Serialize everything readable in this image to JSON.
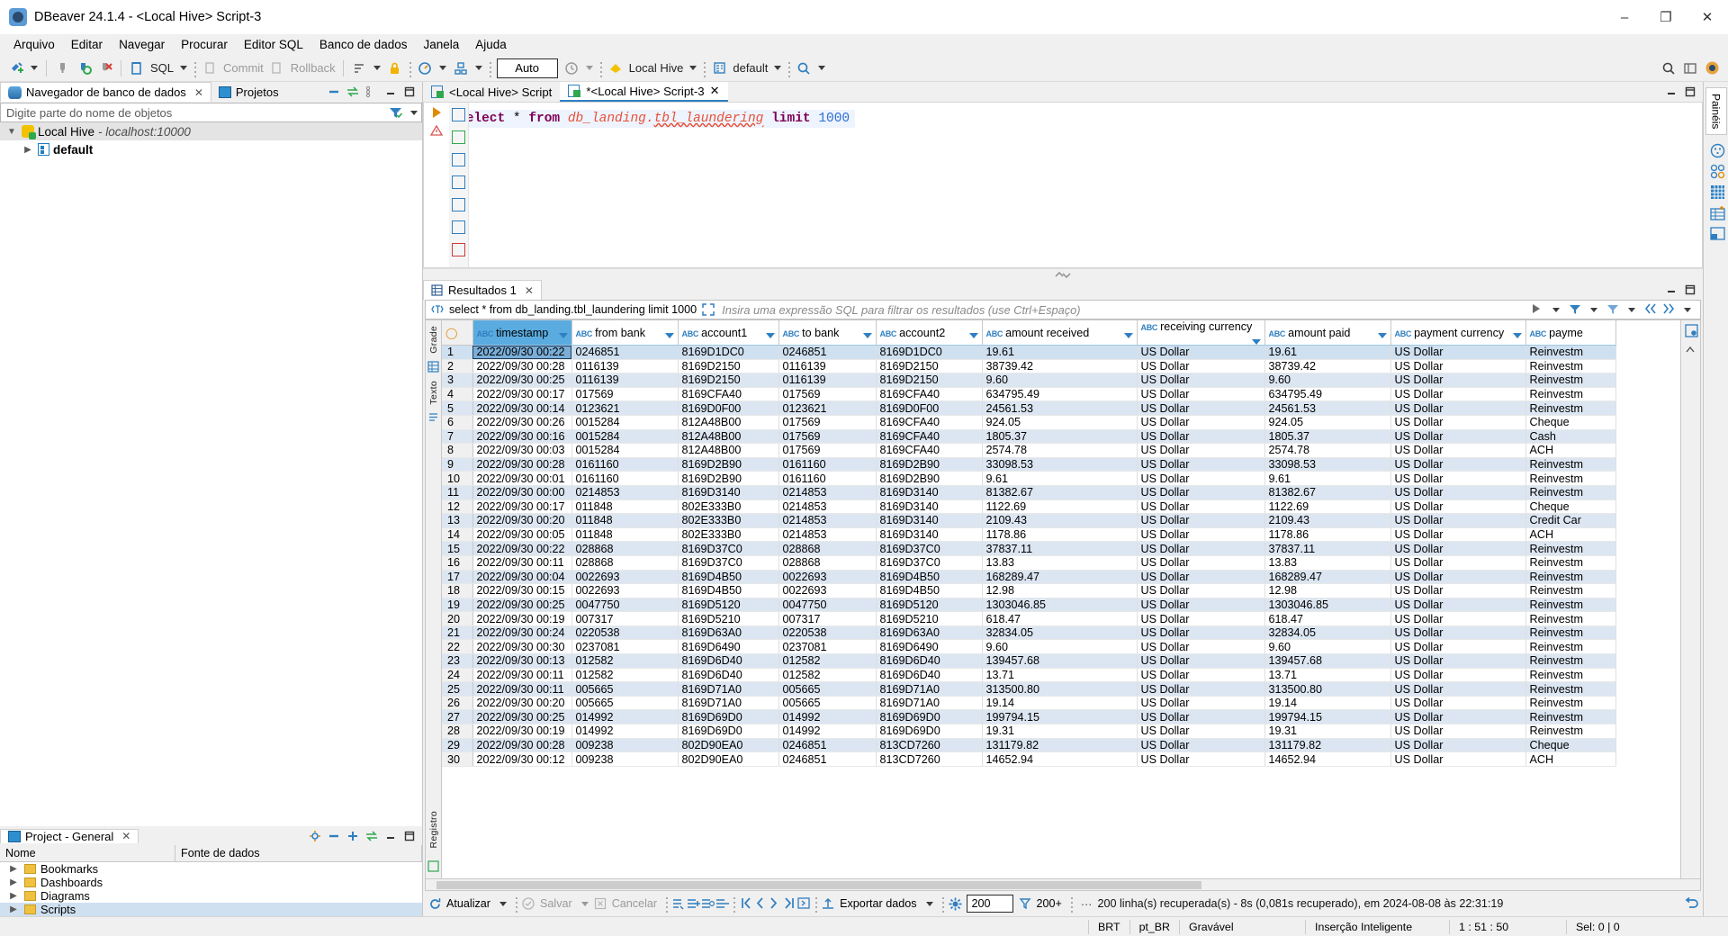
{
  "window": {
    "title": "DBeaver 24.1.4 - <Local Hive> Script-3",
    "minimize": "–",
    "maximize": "❐",
    "close": "✕"
  },
  "menu": [
    "Arquivo",
    "Editar",
    "Navegar",
    "Procurar",
    "Editor SQL",
    "Banco de dados",
    "Janela",
    "Ajuda"
  ],
  "toolbar": {
    "sql_label": "SQL",
    "commit_label": "Commit",
    "rollback_label": "Rollback",
    "auto_label": "Auto",
    "connection_label": "Local Hive",
    "database_label": "default",
    "icons": {
      "new_connection": "new-connection-icon",
      "disconnect": "disconnect-icon",
      "refresh_connection": "refresh-connection-icon",
      "terminate": "terminate-icon",
      "sql_editor": "sql-editor-icon",
      "commit": "commit-icon",
      "rollback": "rollback-icon",
      "transaction_mode": "transaction-mode-icon",
      "lock": "lock-icon",
      "dashboard": "dashboard-icon",
      "schema": "schema-icon",
      "history": "history-icon",
      "search": "search-icon",
      "perspective": "perspective-icon"
    }
  },
  "navigator": {
    "tab_label": "Navegador de banco de dados",
    "projects_tab": "Projetos",
    "filter_placeholder": "Digite parte do nome de objetos",
    "tree": [
      {
        "label": "Local Hive",
        "detail": "- localhost:10000",
        "selected": true,
        "expanded": true
      },
      {
        "label": "default",
        "detail": "",
        "selected": false,
        "expanded": false
      }
    ]
  },
  "project_panel": {
    "tab_label": "Project - General",
    "columns": [
      "Nome",
      "Fonte de dados"
    ],
    "rows": [
      {
        "label": "Bookmarks",
        "selected": false
      },
      {
        "label": "Dashboards",
        "selected": false
      },
      {
        "label": "Diagrams",
        "selected": false
      },
      {
        "label": "Scripts",
        "selected": true
      }
    ]
  },
  "editor": {
    "tabs": [
      {
        "label": "<Local Hive> Script",
        "active": false,
        "closable": false
      },
      {
        "label": "*<Local Hive> Script-3",
        "active": true,
        "closable": true
      }
    ],
    "sql": {
      "keyword1": "select",
      "star": "*",
      "keyword2": "from",
      "schema": "db_landing",
      "dot": ".",
      "table": "tbl_laundering",
      "keyword3": "limit",
      "number": "1000"
    }
  },
  "results": {
    "tab_label": "Resultados 1",
    "query_label": "select * from db_landing.tbl_laundering limit 1000",
    "filter_placeholder": "Insira uma expressão SQL para filtrar os resultados (use Ctrl+Espaço)",
    "side_tabs": [
      "Grade",
      "Texto"
    ],
    "side_tab_bottom": "Registro",
    "panels_tab": "Painéis",
    "columns": [
      "timestamp",
      "from bank",
      "account1",
      "to bank",
      "account2",
      "amount received",
      "receiving currency",
      "amount paid",
      "payment currency",
      "payme"
    ],
    "selected_column": "timestamp",
    "rows": [
      [
        "2022/09/30 00:22",
        "0246851",
        "8169D1DC0",
        "0246851",
        "8169D1DC0",
        "19.61",
        "US Dollar",
        "19.61",
        "US Dollar",
        "Reinvestm"
      ],
      [
        "2022/09/30 00:28",
        "0116139",
        "8169D2150",
        "0116139",
        "8169D2150",
        "38739.42",
        "US Dollar",
        "38739.42",
        "US Dollar",
        "Reinvestm"
      ],
      [
        "2022/09/30 00:25",
        "0116139",
        "8169D2150",
        "0116139",
        "8169D2150",
        "9.60",
        "US Dollar",
        "9.60",
        "US Dollar",
        "Reinvestm"
      ],
      [
        "2022/09/30 00:17",
        "017569",
        "8169CFA40",
        "017569",
        "8169CFA40",
        "634795.49",
        "US Dollar",
        "634795.49",
        "US Dollar",
        "Reinvestm"
      ],
      [
        "2022/09/30 00:14",
        "0123621",
        "8169D0F00",
        "0123621",
        "8169D0F00",
        "24561.53",
        "US Dollar",
        "24561.53",
        "US Dollar",
        "Reinvestm"
      ],
      [
        "2022/09/30 00:26",
        "0015284",
        "812A48B00",
        "017569",
        "8169CFA40",
        "924.05",
        "US Dollar",
        "924.05",
        "US Dollar",
        "Cheque"
      ],
      [
        "2022/09/30 00:16",
        "0015284",
        "812A48B00",
        "017569",
        "8169CFA40",
        "1805.37",
        "US Dollar",
        "1805.37",
        "US Dollar",
        "Cash"
      ],
      [
        "2022/09/30 00:03",
        "0015284",
        "812A48B00",
        "017569",
        "8169CFA40",
        "2574.78",
        "US Dollar",
        "2574.78",
        "US Dollar",
        "ACH"
      ],
      [
        "2022/09/30 00:28",
        "0161160",
        "8169D2B90",
        "0161160",
        "8169D2B90",
        "33098.53",
        "US Dollar",
        "33098.53",
        "US Dollar",
        "Reinvestm"
      ],
      [
        "2022/09/30 00:01",
        "0161160",
        "8169D2B90",
        "0161160",
        "8169D2B90",
        "9.61",
        "US Dollar",
        "9.61",
        "US Dollar",
        "Reinvestm"
      ],
      [
        "2022/09/30 00:00",
        "0214853",
        "8169D3140",
        "0214853",
        "8169D3140",
        "81382.67",
        "US Dollar",
        "81382.67",
        "US Dollar",
        "Reinvestm"
      ],
      [
        "2022/09/30 00:17",
        "011848",
        "802E333B0",
        "0214853",
        "8169D3140",
        "1122.69",
        "US Dollar",
        "1122.69",
        "US Dollar",
        "Cheque"
      ],
      [
        "2022/09/30 00:20",
        "011848",
        "802E333B0",
        "0214853",
        "8169D3140",
        "2109.43",
        "US Dollar",
        "2109.43",
        "US Dollar",
        "Credit Car"
      ],
      [
        "2022/09/30 00:05",
        "011848",
        "802E333B0",
        "0214853",
        "8169D3140",
        "1178.86",
        "US Dollar",
        "1178.86",
        "US Dollar",
        "ACH"
      ],
      [
        "2022/09/30 00:22",
        "028868",
        "8169D37C0",
        "028868",
        "8169D37C0",
        "37837.11",
        "US Dollar",
        "37837.11",
        "US Dollar",
        "Reinvestm"
      ],
      [
        "2022/09/30 00:11",
        "028868",
        "8169D37C0",
        "028868",
        "8169D37C0",
        "13.83",
        "US Dollar",
        "13.83",
        "US Dollar",
        "Reinvestm"
      ],
      [
        "2022/09/30 00:04",
        "0022693",
        "8169D4B50",
        "0022693",
        "8169D4B50",
        "168289.47",
        "US Dollar",
        "168289.47",
        "US Dollar",
        "Reinvestm"
      ],
      [
        "2022/09/30 00:15",
        "0022693",
        "8169D4B50",
        "0022693",
        "8169D4B50",
        "12.98",
        "US Dollar",
        "12.98",
        "US Dollar",
        "Reinvestm"
      ],
      [
        "2022/09/30 00:25",
        "0047750",
        "8169D5120",
        "0047750",
        "8169D5120",
        "1303046.85",
        "US Dollar",
        "1303046.85",
        "US Dollar",
        "Reinvestm"
      ],
      [
        "2022/09/30 00:19",
        "007317",
        "8169D5210",
        "007317",
        "8169D5210",
        "618.47",
        "US Dollar",
        "618.47",
        "US Dollar",
        "Reinvestm"
      ],
      [
        "2022/09/30 00:24",
        "0220538",
        "8169D63A0",
        "0220538",
        "8169D63A0",
        "32834.05",
        "US Dollar",
        "32834.05",
        "US Dollar",
        "Reinvestm"
      ],
      [
        "2022/09/30 00:30",
        "0237081",
        "8169D6490",
        "0237081",
        "8169D6490",
        "9.60",
        "US Dollar",
        "9.60",
        "US Dollar",
        "Reinvestm"
      ],
      [
        "2022/09/30 00:13",
        "012582",
        "8169D6D40",
        "012582",
        "8169D6D40",
        "139457.68",
        "US Dollar",
        "139457.68",
        "US Dollar",
        "Reinvestm"
      ],
      [
        "2022/09/30 00:11",
        "012582",
        "8169D6D40",
        "012582",
        "8169D6D40",
        "13.71",
        "US Dollar",
        "13.71",
        "US Dollar",
        "Reinvestm"
      ],
      [
        "2022/09/30 00:11",
        "005665",
        "8169D71A0",
        "005665",
        "8169D71A0",
        "313500.80",
        "US Dollar",
        "313500.80",
        "US Dollar",
        "Reinvestm"
      ],
      [
        "2022/09/30 00:20",
        "005665",
        "8169D71A0",
        "005665",
        "8169D71A0",
        "19.14",
        "US Dollar",
        "19.14",
        "US Dollar",
        "Reinvestm"
      ],
      [
        "2022/09/30 00:25",
        "014992",
        "8169D69D0",
        "014992",
        "8169D69D0",
        "199794.15",
        "US Dollar",
        "199794.15",
        "US Dollar",
        "Reinvestm"
      ],
      [
        "2022/09/30 00:19",
        "014992",
        "8169D69D0",
        "014992",
        "8169D69D0",
        "19.31",
        "US Dollar",
        "19.31",
        "US Dollar",
        "Reinvestm"
      ],
      [
        "2022/09/30 00:28",
        "009238",
        "802D90EA0",
        "0246851",
        "813CD7260",
        "131179.82",
        "US Dollar",
        "131179.82",
        "US Dollar",
        "Cheque"
      ],
      [
        "2022/09/30 00:12",
        "009238",
        "802D90EA0",
        "0246851",
        "813CD7260",
        "14652.94",
        "US Dollar",
        "14652.94",
        "US Dollar",
        "ACH"
      ]
    ]
  },
  "resultbar": {
    "refresh_label": "Atualizar",
    "save_label": "Salvar",
    "cancel_label": "Cancelar",
    "export_label": "Exportar dados",
    "fetch_size": "200",
    "fetch_more": "200+",
    "ellipsis": "⋯",
    "status": "200 linha(s) recuperada(s) - 8s (0,081s recuperado), em 2024-08-08 às 22:31:19"
  },
  "statusbar": {
    "timezone": "BRT",
    "locale": "pt_BR",
    "writable": "Gravável",
    "insert_mode": "Inserção Inteligente",
    "position": "1 : 51 : 50",
    "selection": "Sel: 0 | 0"
  }
}
